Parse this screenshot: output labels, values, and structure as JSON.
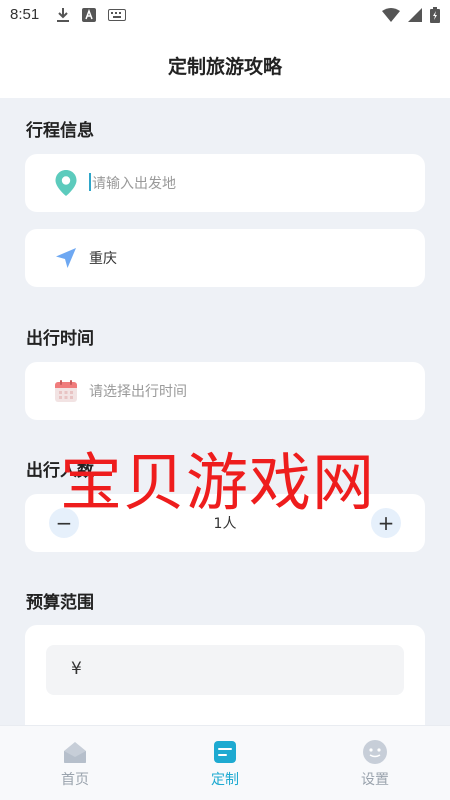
{
  "status_bar": {
    "time": "8:51"
  },
  "header": {
    "title": "定制旅游攻略"
  },
  "itinerary": {
    "section_title": "行程信息",
    "departure_placeholder": "请输入出发地",
    "destination": "重庆"
  },
  "time": {
    "section_title": "出行时间",
    "placeholder": "请选择出行时间"
  },
  "people": {
    "section_title": "出行人数",
    "minus_label": "−",
    "plus_label": "+",
    "value": "1人"
  },
  "budget": {
    "section_title": "预算范围",
    "currency_symbol": "¥"
  },
  "watermark": "宝贝游戏网",
  "tabs": [
    {
      "label": "首页",
      "icon": "home-icon",
      "active": false
    },
    {
      "label": "定制",
      "icon": "customize-icon",
      "active": true
    },
    {
      "label": "设置",
      "icon": "settings-icon",
      "active": false
    }
  ],
  "colors": {
    "accent": "#1eaad1",
    "background": "#eef1f6",
    "watermark": "#ee1d1d"
  }
}
